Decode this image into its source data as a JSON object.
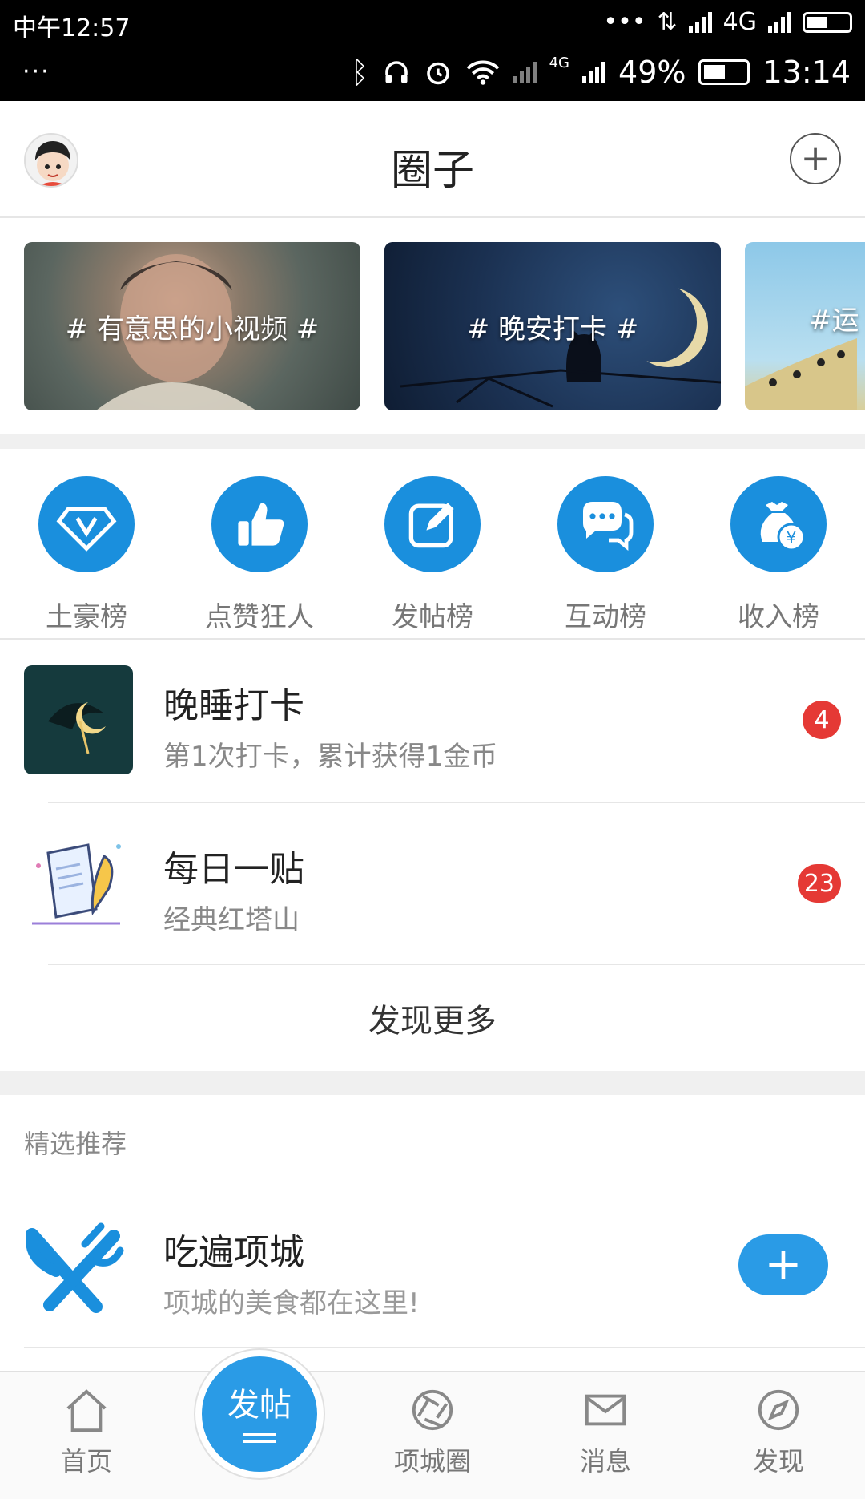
{
  "status_bar": {
    "time_top": "中午12:57",
    "network_top": "4G",
    "dots_left": "···",
    "network_small": "4G",
    "battery": "49%",
    "time": "13:14"
  },
  "header": {
    "title": "圈子",
    "add_symbol": "+"
  },
  "banners": [
    {
      "label": "# 有意思的小视频 #"
    },
    {
      "label": "# 晚安打卡 #"
    },
    {
      "label": "#运"
    }
  ],
  "rankings": [
    {
      "label": "土豪榜",
      "icon": "diamond-v-icon"
    },
    {
      "label": "点赞狂人",
      "icon": "thumbs-up-icon"
    },
    {
      "label": "发帖榜",
      "icon": "edit-icon"
    },
    {
      "label": "互动榜",
      "icon": "chat-bubbles-icon"
    },
    {
      "label": "收入榜",
      "icon": "money-bag-icon"
    }
  ],
  "circles": [
    {
      "title": "晚睡打卡",
      "subtitle": "第1次打卡，累计获得1金币",
      "badge": "4"
    },
    {
      "title": "每日一贴",
      "subtitle": "经典红塔山",
      "badge": "23"
    }
  ],
  "more_label": "发现更多",
  "featured": {
    "section_title": "精选推荐",
    "item": {
      "title": "吃遍项城",
      "subtitle": "项城的美食都在这里!",
      "join_symbol": "+"
    }
  },
  "bottom_nav": {
    "items": [
      {
        "label": "首页",
        "icon": "home-icon"
      },
      {
        "label": "项城圈",
        "icon": "aperture-icon"
      },
      {
        "label": "消息",
        "icon": "mail-icon"
      },
      {
        "label": "发现",
        "icon": "compass-icon"
      }
    ],
    "post_label": "发帖"
  },
  "colors": {
    "accent": "#1a8fdd",
    "badge": "#e53935",
    "button": "#2a9be6"
  }
}
